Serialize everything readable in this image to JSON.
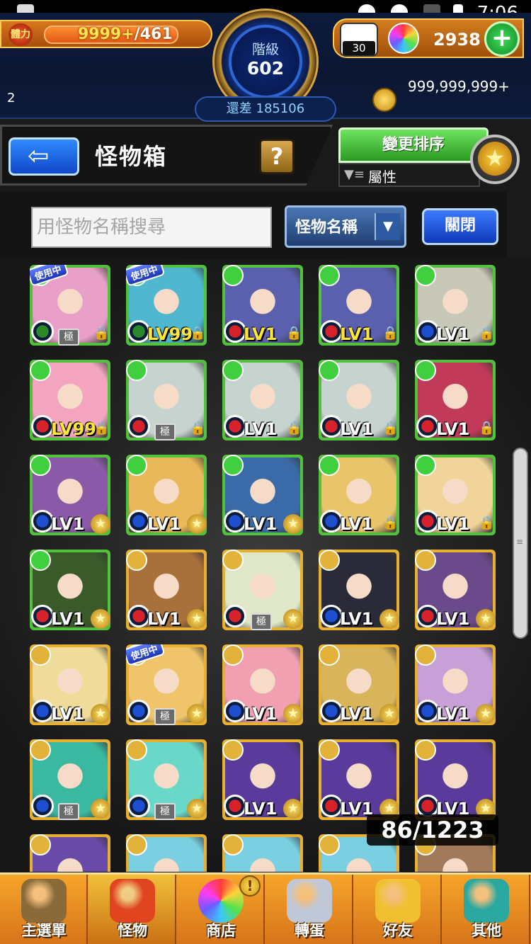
{
  "status_bar": {
    "time": "7:06"
  },
  "hud": {
    "stamina_icon_label": "體力",
    "stamina_current": "9999+",
    "stamina_max": "/461",
    "rank_label": "階級",
    "rank_value": "602",
    "exp_remaining": "還差 185106",
    "orb_small_count": "30",
    "orb_count": "2938",
    "coin_count": "999,999,999+",
    "left_number": "2"
  },
  "header": {
    "title": "怪物箱",
    "help_label": "?",
    "sort_label": "變更排序",
    "filter_label": "屬性"
  },
  "search": {
    "placeholder": "用怪物名稱搜尋",
    "select_value": "怪物名稱",
    "close_label": "關閉"
  },
  "grid": {
    "count_text": "86/1223",
    "cells": [
      {
        "level": "",
        "element": "#3fcf3f",
        "frame": "#52c23a",
        "art": "#e8a0c8",
        "orb": "wood",
        "tag": "使用中",
        "kiwami": "極",
        "lock": true,
        "star": false
      },
      {
        "level": "LV99",
        "gold": true,
        "element": "#3fcf3f",
        "frame": "#52c23a",
        "art": "#4fb7d0",
        "orb": "wood",
        "tag": "使用中",
        "lock": true,
        "star": false
      },
      {
        "level": "LV1",
        "gold": true,
        "element": "#3fcf3f",
        "frame": "#52c23a",
        "art": "#5a5fae",
        "orb": "fire",
        "lock": true,
        "star": false
      },
      {
        "level": "LV1",
        "gold": true,
        "element": "#3fcf3f",
        "frame": "#52c23a",
        "art": "#5a5fae",
        "orb": "fire",
        "lock": true,
        "star": false
      },
      {
        "level": "LV1",
        "element": "#3fcf3f",
        "frame": "#52c23a",
        "art": "#c8c8b8",
        "orb": "water",
        "lock": true,
        "star": false
      },
      {
        "level": "LV99",
        "gold": true,
        "element": "#3fcf3f",
        "frame": "#52c23a",
        "art": "#f3a5c0",
        "orb": "fire",
        "lock": true,
        "star": false
      },
      {
        "level": "",
        "element": "#3fcf3f",
        "frame": "#52c23a",
        "art": "#c7d3cf",
        "orb": "fire",
        "kiwami": "極",
        "lock": true,
        "star": false
      },
      {
        "level": "LV1",
        "element": "#3fcf3f",
        "frame": "#52c23a",
        "art": "#c7d3cf",
        "orb": "fire",
        "lock": true,
        "star": false
      },
      {
        "level": "LV1",
        "element": "#3fcf3f",
        "frame": "#52c23a",
        "art": "#c7d3cf",
        "orb": "fire",
        "lock": true,
        "star": false
      },
      {
        "level": "LV1",
        "element": "#3fcf3f",
        "frame": "#52c23a",
        "art": "#c23a5a",
        "orb": "fire",
        "lock": true,
        "star": false
      },
      {
        "level": "LV1",
        "element": "#3fcf3f",
        "frame": "#52c23a",
        "art": "#8a5aa8",
        "orb": "water",
        "lock": false,
        "star": true
      },
      {
        "level": "LV1",
        "element": "#3fcf3f",
        "frame": "#52c23a",
        "art": "#e8b85a",
        "orb": "water",
        "lock": false,
        "star": true
      },
      {
        "level": "LV1",
        "element": "#3fcf3f",
        "frame": "#52c23a",
        "art": "#3a6aa8",
        "orb": "water",
        "lock": false,
        "star": true
      },
      {
        "level": "LV1",
        "element": "#3fcf3f",
        "frame": "#52c23a",
        "art": "#e8c46a",
        "orb": "water",
        "lock": true,
        "star": false
      },
      {
        "level": "LV1",
        "element": "#3fcf3f",
        "frame": "#52c23a",
        "art": "#f0d49a",
        "orb": "fire",
        "lock": true,
        "star": false
      },
      {
        "level": "LV1",
        "element": "#3fcf3f",
        "frame": "#52c23a",
        "art": "#3a5a2a",
        "orb": "fire",
        "lock": false,
        "star": true
      },
      {
        "level": "LV1",
        "element": "#e2b23a",
        "frame": "#e8b030",
        "art": "#a8703a",
        "orb": "fire",
        "lock": false,
        "star": true
      },
      {
        "level": "",
        "element": "#e2b23a",
        "frame": "#e8b030",
        "art": "#dfe7c8",
        "orb": "fire",
        "kiwami": "極",
        "lock": false,
        "star": true
      },
      {
        "level": "LV1",
        "element": "#e2b23a",
        "frame": "#e8b030",
        "art": "#2a2a38",
        "orb": "water",
        "lock": false,
        "star": true
      },
      {
        "level": "LV1",
        "element": "#e2b23a",
        "frame": "#e8b030",
        "art": "#6a4a8a",
        "orb": "fire",
        "lock": false,
        "star": true
      },
      {
        "level": "LV1",
        "element": "#e2b23a",
        "frame": "#e8b030",
        "art": "#f0dc9a",
        "orb": "water",
        "lock": false,
        "star": true
      },
      {
        "level": "",
        "element": "#e2b23a",
        "frame": "#e8b030",
        "art": "#f0c46a",
        "orb": "water",
        "tag": "使用中",
        "kiwami": "極",
        "lock": false,
        "star": true
      },
      {
        "level": "LV1",
        "element": "#e2b23a",
        "frame": "#e8b030",
        "art": "#f0a0b0",
        "orb": "water",
        "lock": false,
        "star": true
      },
      {
        "level": "LV1",
        "element": "#e2b23a",
        "frame": "#e8b030",
        "art": "#d8b45a",
        "orb": "water",
        "lock": false,
        "star": true
      },
      {
        "level": "LV1",
        "element": "#e2b23a",
        "frame": "#e8b030",
        "art": "#c8a0d8",
        "orb": "water",
        "lock": false,
        "star": true
      },
      {
        "level": "",
        "element": "#e2b23a",
        "frame": "#e8b030",
        "art": "#3ab8a0",
        "orb": "water",
        "kiwami": "極",
        "lock": false,
        "star": true
      },
      {
        "level": "",
        "element": "#e2b23a",
        "frame": "#e8b030",
        "art": "#6ad8c8",
        "orb": "water",
        "kiwami": "極",
        "lock": false,
        "star": true
      },
      {
        "level": "LV1",
        "element": "#e2b23a",
        "frame": "#e8b030",
        "art": "#5a3a9a",
        "orb": "fire",
        "lock": false,
        "star": true
      },
      {
        "level": "LV1",
        "element": "#e2b23a",
        "frame": "#e8b030",
        "art": "#5a3a9a",
        "orb": "fire",
        "lock": false,
        "star": true
      },
      {
        "level": "LV1",
        "element": "#e2b23a",
        "frame": "#e8b030",
        "art": "#5a3a9a",
        "orb": "fire",
        "lock": false,
        "star": true
      },
      {
        "level": "",
        "element": "#e2b23a",
        "frame": "#e8b030",
        "art": "#6a4aa8",
        "orb": "",
        "lock": false,
        "star": false
      },
      {
        "level": "",
        "element": "#e2b23a",
        "frame": "#e8b030",
        "art": "#7ad0e0",
        "orb": "",
        "lock": false,
        "star": false
      },
      {
        "level": "",
        "element": "#e2b23a",
        "frame": "#e8b030",
        "art": "#7ad0e0",
        "orb": "",
        "lock": false,
        "star": false
      },
      {
        "level": "",
        "element": "#e2b23a",
        "frame": "#e8b030",
        "art": "#7ad0e0",
        "orb": "",
        "lock": false,
        "star": false
      },
      {
        "level": "",
        "element": "#e2b23a",
        "frame": "#e8b030",
        "art": "#a07a5a",
        "orb": "",
        "lock": false,
        "star": false
      }
    ]
  },
  "nav": {
    "items": [
      {
        "label": "主選單",
        "icon": "castle-icon",
        "color": "#8a6a3a"
      },
      {
        "label": "怪物",
        "icon": "monster-icon",
        "color": "#e0451f",
        "active": true
      },
      {
        "label": "商店",
        "icon": "orb-icon",
        "color": "rainbow"
      },
      {
        "label": "轉蛋",
        "icon": "gacha-icon",
        "color": "#c0c8d8"
      },
      {
        "label": "好友",
        "icon": "friends-icon",
        "color": "#f0c030"
      },
      {
        "label": "其他",
        "icon": "question-icon",
        "color": "#2aa8a0"
      }
    ],
    "alert_label": "!"
  },
  "colors": {
    "accent_blue": "#1f4fd0",
    "accent_green": "#3fb52f",
    "nav_orange": "#e8891f"
  }
}
